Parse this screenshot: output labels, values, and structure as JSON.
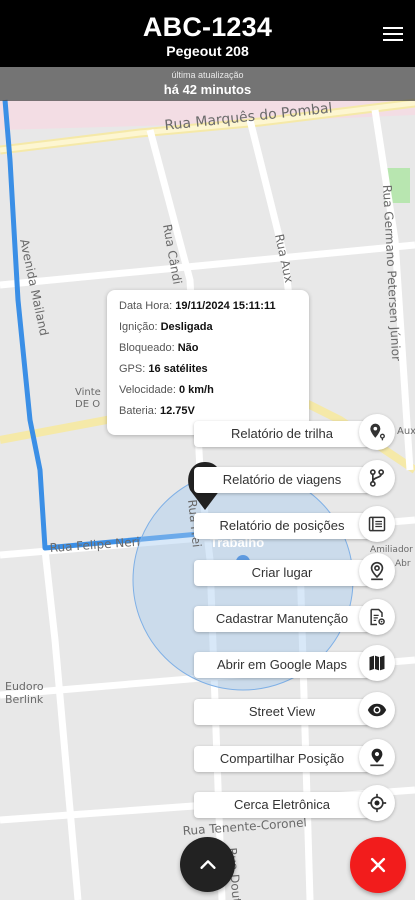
{
  "header": {
    "plate": "ABC-1234",
    "model": "Pegeout 208",
    "update_label": "última atualização",
    "update_value": "há 42 minutos"
  },
  "map": {
    "streets": {
      "marques_pombal": "Rua Marquês do Pombal",
      "germano_petersen": "Rua Germano Petersen Júnior",
      "candido": "Rua Cândi",
      "aux": "Rua Aux",
      "avenida_mailand": "Avenida Mailand",
      "felipe_neri": "Rua Felipe Neri",
      "tenente_coronel": "Rua Tenente-Coronel",
      "doutor": "Rua Dout",
      "frei": "Rua Frei",
      "eudoro": "Eudoro",
      "berlink": "Berlink"
    },
    "poi": {
      "vinte": "Vinte",
      "de_o": "DE O",
      "auxi": "Auxi",
      "amiliador": "Amiliador",
      "abrigo": "Abr",
      "trabalho": "Trabalho"
    }
  },
  "info_card": {
    "rows": [
      {
        "label": "Data Hora:",
        "value": "19/11/2024 15:11:11"
      },
      {
        "label": "Ignição:",
        "value": "Desligada"
      },
      {
        "label": "Bloqueado:",
        "value": "Não"
      },
      {
        "label": "GPS:",
        "value": "16 satélites"
      },
      {
        "label": "Velocidade:",
        "value": "0 km/h"
      },
      {
        "label": "Bateria:",
        "value": "12.75V"
      }
    ]
  },
  "actions": [
    {
      "label": "Relatório de trilha",
      "icon": "route-pin-icon"
    },
    {
      "label": "Relatório de viagens",
      "icon": "trips-fork-icon"
    },
    {
      "label": "Relatório de posições",
      "icon": "list-report-icon"
    },
    {
      "label": "Criar lugar",
      "icon": "add-place-icon"
    },
    {
      "label": "Cadastrar Manutenção",
      "icon": "maintenance-doc-icon"
    },
    {
      "label": "Abrir em Google Maps",
      "icon": "map-icon"
    },
    {
      "label": "Street View",
      "icon": "eye-icon"
    },
    {
      "label": "Compartilhar Posição",
      "icon": "share-location-icon"
    },
    {
      "label": "Cerca Eletrônica",
      "icon": "geofence-target-icon"
    }
  ],
  "colors": {
    "header_bg": "#000000",
    "route": "#3b8fe6",
    "geofence": "#9cc4ef",
    "close_button": "#f21c1c",
    "up_button": "#222222"
  }
}
